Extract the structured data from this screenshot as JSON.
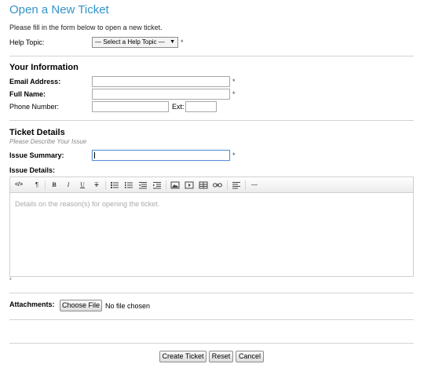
{
  "page": {
    "title": "Open a New Ticket",
    "intro": "Please fill in the form below to open a new ticket."
  },
  "help_topic": {
    "label": "Help Topic:",
    "selected": "— Select a Help Topic —",
    "required_mark": "*"
  },
  "your_info": {
    "heading": "Your Information",
    "email_label": "Email Address:",
    "fullname_label": "Full Name:",
    "phone_label": "Phone Number:",
    "ext_label": "Ext:",
    "required_mark": "*"
  },
  "ticket_details": {
    "heading": "Ticket Details",
    "subheading": "Please Describe Your Issue",
    "summary_label": "Issue Summary:",
    "details_label": "Issue Details:",
    "details_placeholder": "Details on the reason(s) for opening the ticket.",
    "required_mark": "*"
  },
  "toolbar": {
    "buttons": [
      {
        "name": "code-view-icon",
        "glyph": "</>"
      },
      {
        "name": "paragraph-format-icon",
        "glyph": "¶"
      },
      {
        "name": "bold-icon",
        "glyph": "B"
      },
      {
        "name": "italic-icon",
        "glyph": "I"
      },
      {
        "name": "underline-icon",
        "glyph": "U"
      },
      {
        "name": "strikethrough-icon",
        "glyph": "T"
      },
      {
        "name": "unordered-list-icon",
        "glyph": ""
      },
      {
        "name": "ordered-list-icon",
        "glyph": ""
      },
      {
        "name": "outdent-icon",
        "glyph": ""
      },
      {
        "name": "indent-icon",
        "glyph": ""
      },
      {
        "name": "image-icon",
        "glyph": ""
      },
      {
        "name": "video-icon",
        "glyph": ""
      },
      {
        "name": "table-icon",
        "glyph": ""
      },
      {
        "name": "link-icon",
        "glyph": ""
      },
      {
        "name": "align-icon",
        "glyph": ""
      },
      {
        "name": "horizontal-rule-icon",
        "glyph": "—"
      }
    ]
  },
  "attachments": {
    "label": "Attachments:",
    "choose_button": "Choose File",
    "status": "No file chosen"
  },
  "actions": {
    "create": "Create Ticket",
    "reset": "Reset",
    "cancel": "Cancel"
  },
  "colors": {
    "title": "#3394c9",
    "divider": "#d3d3d3",
    "focus_border": "#5b8fd9"
  }
}
